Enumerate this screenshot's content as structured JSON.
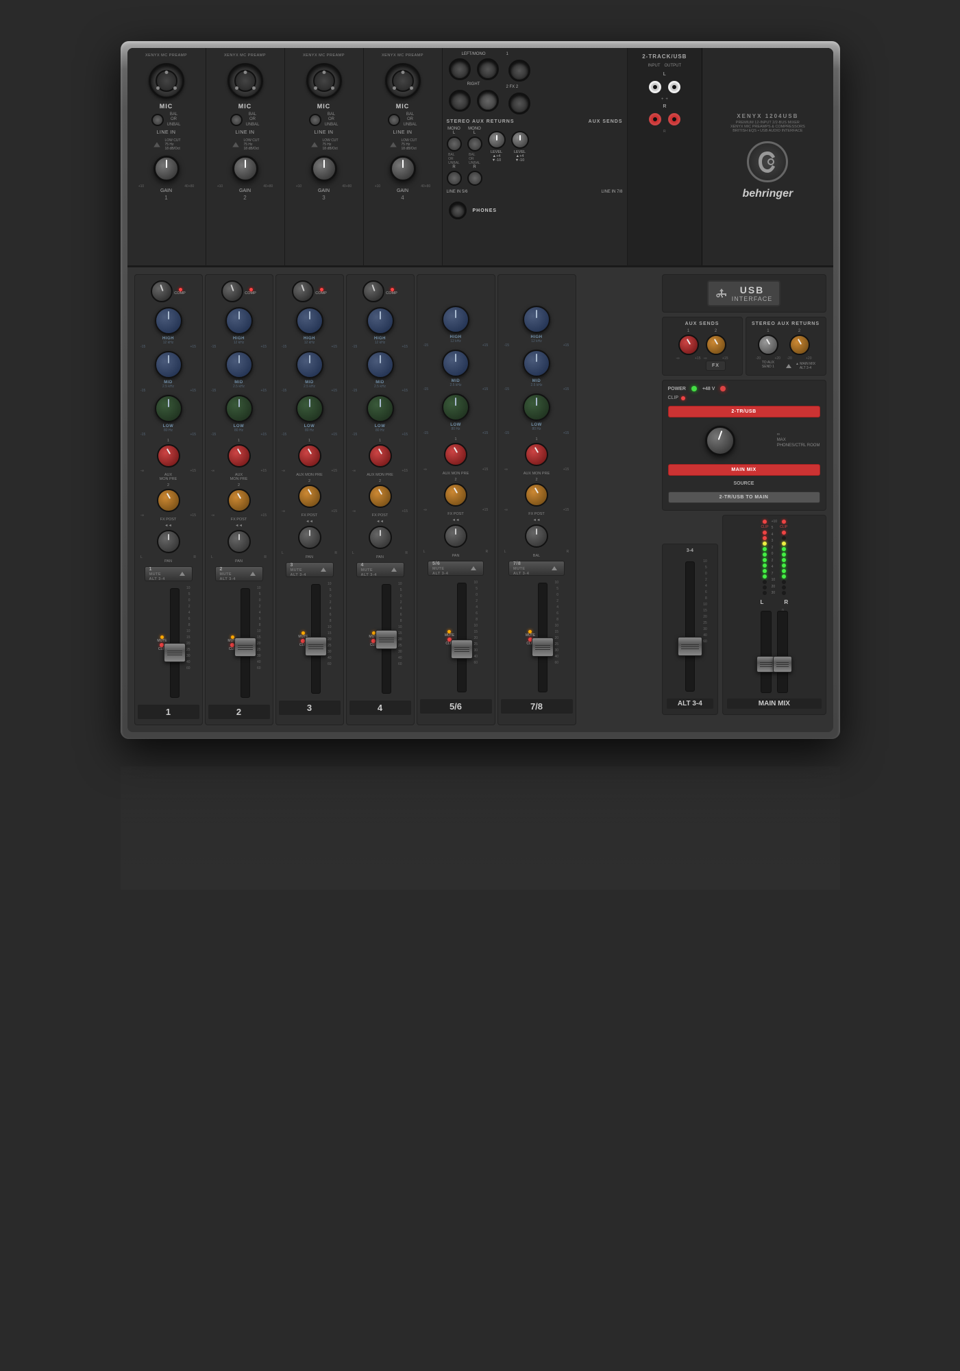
{
  "mixer": {
    "brand": "behringer",
    "model": "XENYX 1204USB",
    "tagline1": "PREMIUM 12-INPUT 2/2-BUS MIXER",
    "tagline2": "XENYX MIC PREAMPS & COMPRESSORS",
    "tagline3": "BRITISH EQS • USB AUDIO INTERFACE",
    "usb_badge": "USB",
    "interface_label": "INTERFACE",
    "usb_symbol": "⚡"
  },
  "top_section": {
    "channels": [
      {
        "label": "XENYX MC PREAMP",
        "mic": "MIC",
        "line": "LINE IN",
        "bal": "BAL",
        "unbal": "OR UNBAL",
        "gain": "GAIN",
        "number": "1",
        "low_cut": "LOW CUT 75 Hz 18 dB/Oct"
      },
      {
        "label": "XENYX MC PREAMP",
        "mic": "MIC",
        "line": "LINE IN",
        "bal": "BAL",
        "unbal": "OR UNBAL",
        "gain": "GAIN",
        "number": "2",
        "low_cut": "LOW CUT 75 Hz 18 dB/Oct"
      },
      {
        "label": "XENYX MC PREAMP",
        "mic": "MIC",
        "line": "LINE IN",
        "bal": "BAL",
        "unbal": "OR UNBAL",
        "gain": "GAIN",
        "number": "3",
        "low_cut": "LOW CUT 75 Hz 18 dB/Oct"
      },
      {
        "label": "XENYX MC PREAMP",
        "mic": "MIC",
        "line": "LINE IN",
        "bal": "BAL",
        "unbal": "OR UNBAL",
        "gain": "GAIN",
        "number": "4",
        "low_cut": "LOW CUT 75 Hz 18 dB/Oct"
      }
    ],
    "stereo_left_mono": "LEFT/MONO",
    "stereo_right": "RIGHT",
    "stereo_aux_returns": "STEREO AUX RETURNS",
    "aux_sends": "AUX SENDS",
    "line_in_56": "LINE IN 5/6",
    "line_in_78": "LINE IN 7/8",
    "mono_label": "MONO",
    "level_plus": "+4",
    "level_minus": "▼-10",
    "phones": "PHONES",
    "two_track": "2-TRACK/USB",
    "input_label": "INPUT",
    "output_label": "OUTPUT"
  },
  "main_section": {
    "channels": [
      {
        "number": "1",
        "comp": "COMP",
        "eq_high": "HIGH",
        "eq_high_freq": "12 kHz",
        "eq_mid": "MID",
        "eq_mid_freq": "2.5 kHz",
        "eq_low": "LOW",
        "eq_low_freq": "80 Hz",
        "aux1": "AUX 1",
        "aux2": "2",
        "fx": "FX",
        "pan": "PAN",
        "mute": "MUTE",
        "alt": "ALT 3-4",
        "mon_pre": "MON PRE",
        "fx_post": "FX POST"
      },
      {
        "number": "2",
        "comp": "COMP",
        "eq_high": "HIGH",
        "eq_high_freq": "12 kHz",
        "eq_mid": "MID",
        "eq_mid_freq": "2.5 kHz",
        "eq_low": "LOW",
        "eq_low_freq": "80 Hz",
        "aux1": "AUX 1",
        "aux2": "2",
        "fx": "FX",
        "pan": "PAN",
        "mute": "MUTE",
        "alt": "ALT 3-4",
        "mon_pre": "MON PRE",
        "fx_post": "FX POST"
      },
      {
        "number": "3",
        "comp": "COMP",
        "eq_high": "HIGH",
        "eq_high_freq": "12 kHz",
        "eq_mid": "MID",
        "eq_mid_freq": "2.5 kHz",
        "eq_low": "LOW",
        "eq_low_freq": "80 Hz",
        "aux1": "AUX 1",
        "aux2": "2",
        "fx": "FX",
        "pan": "PAN",
        "mute": "MUTE",
        "alt": "ALT 3-4",
        "mon_pre": "MON PRE",
        "fx_post": "FX POST"
      },
      {
        "number": "4",
        "comp": "COMP",
        "eq_high": "HIGH",
        "eq_high_freq": "12 kHz",
        "eq_mid": "MID",
        "eq_mid_freq": "2.5 kHz",
        "eq_low": "LOW",
        "eq_low_freq": "80 Hz",
        "aux1": "AUX 1",
        "aux2": "2",
        "fx": "FX",
        "pan": "PAN",
        "mute": "MUTE",
        "alt": "ALT 3-4",
        "mon_pre": "MON PRE",
        "fx_post": "FX POST"
      },
      {
        "number": "5/6",
        "comp": "",
        "eq_high": "HIGH",
        "eq_high_freq": "12 kHz",
        "eq_mid": "MID",
        "eq_mid_freq": "2.5 kHz",
        "eq_low": "LOW",
        "eq_low_freq": "80 Hz",
        "aux1": "AUX 1",
        "aux2": "2",
        "fx": "FX",
        "pan": "PAN",
        "mute": "MUTE",
        "alt": "ALT 3-4",
        "mon_pre": "MON PRE",
        "fx_post": "FX POST"
      },
      {
        "number": "7/8",
        "comp": "",
        "eq_high": "HIGH",
        "eq_high_freq": "12 kHz",
        "eq_mid": "MID",
        "eq_mid_freq": "2.5 kHz",
        "eq_low": "LOW",
        "eq_low_freq": "80 Hz",
        "aux1": "AUX 1",
        "aux2": "2",
        "fx": "FX",
        "pan": "BAL",
        "mute": "MUTE",
        "alt": "ALT 3-4",
        "mon_pre": "MON PRE",
        "fx_post": "FX POST"
      }
    ],
    "aux_sends_label": "AUX SENDS",
    "stereo_returns_label": "STEREO AUX RETURNS",
    "to_aux_send": "TO AUX SEND 1",
    "main_mix_label": "▲ MAIN MIX ALT 3-4",
    "fx_label": "FX",
    "power_label": "POWER",
    "phantom_label": "+48 V",
    "clip_label": "CLIP",
    "two_tr_usb": "2-TR/USB",
    "alt_34": "ALT 3-4",
    "phones_ctrl": "PHONES/CTRL ROOM",
    "max_label": "MAX",
    "main_mix_button": "MAIN MIX",
    "source_label": "SOURCE",
    "two_tr_to_main": "2-TR/USB TO MAIN",
    "alt_34_label": "3-4",
    "main_mix_final": "MAIN MIX",
    "l_label": "L",
    "r_label": "R",
    "fader_marks": [
      "-10",
      "0",
      "2",
      "4",
      "6",
      "8",
      "10",
      "15",
      "20",
      "30",
      "40",
      "60"
    ]
  },
  "meter": {
    "clip_top": "CLIP",
    "values": [
      "+10",
      "5",
      "4",
      "3",
      "2",
      "0",
      "2",
      "4",
      "7",
      "10",
      "20",
      "30"
    ]
  }
}
